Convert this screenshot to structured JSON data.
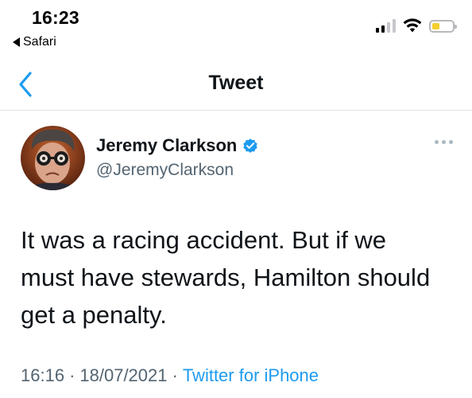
{
  "status_bar": {
    "time": "16:23",
    "back_app": "Safari",
    "signal_colors": [
      "#000000",
      "#000000",
      "#c7c7cc",
      "#c7c7cc"
    ],
    "battery_color": "#f5cf2f"
  },
  "nav": {
    "back_icon": "chevron-left-icon",
    "title": "Tweet",
    "accent": "#1d9bf0"
  },
  "tweet": {
    "author_name": "Jeremy Clarkson",
    "verified_icon": "verified-badge-icon",
    "handle": "@JeremyClarkson",
    "more_icon": "more-horizontal-icon",
    "text": "It was a racing accident. But if we must have stewards, Hamilton should get a penalty.",
    "time": "16:16",
    "separator": "·",
    "date": "18/07/2021",
    "source": "Twitter for iPhone"
  }
}
